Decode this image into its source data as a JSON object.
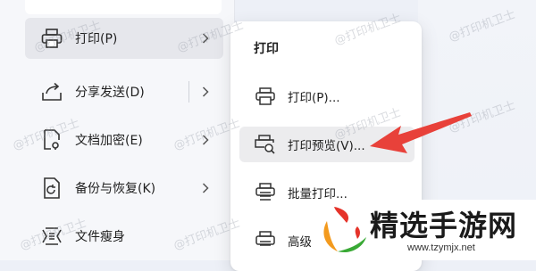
{
  "left_menu": {
    "items": [
      {
        "label": "打印(P)"
      },
      {
        "label": "分享发送(D)"
      },
      {
        "label": "文档加密(E)"
      },
      {
        "label": "备份与恢复(K)"
      },
      {
        "label": "文件瘦身"
      }
    ]
  },
  "submenu": {
    "title": "打印",
    "items": [
      {
        "label": "打印(P)..."
      },
      {
        "label": "打印预览(V)..."
      },
      {
        "label": "批量打印..."
      },
      {
        "label": "高级"
      }
    ]
  },
  "watermark": "@打印机卫士",
  "logo": {
    "brand": "精选手游网",
    "url": "www.tzymjx.net"
  },
  "colors": {
    "arrow": "#e8413a",
    "logo_orange": "#f39a1e",
    "logo_red": "#e5332a",
    "logo_green": "#39a935"
  },
  "icons": {
    "print": "printer-icon",
    "share": "share-icon",
    "encrypt": "document-lock-icon",
    "backup": "backup-restore-icon",
    "slim": "compress-file-icon",
    "preview": "print-preview-icon",
    "batch": "batch-print-icon",
    "chevron": "chevron-right-icon"
  }
}
